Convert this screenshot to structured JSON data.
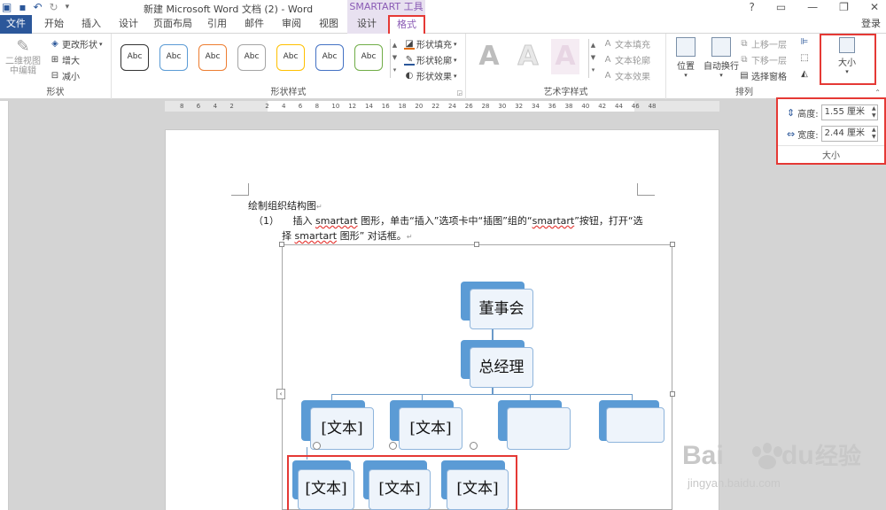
{
  "titlebar": {
    "doc_title": "新建 Microsoft Word 文档 (2) - Word",
    "context_label": "SMARTART 工具",
    "win_help": "?",
    "win_minimize": "—",
    "win_restore": "❐",
    "win_close": "✕"
  },
  "tabs": {
    "file": "文件",
    "items": [
      "开始",
      "插入",
      "设计",
      "页面布局",
      "引用",
      "邮件",
      "审阅",
      "视图"
    ],
    "ctx_design": "设计",
    "ctx_format": "格式",
    "login": "登录"
  },
  "ribbon": {
    "shape_group": {
      "label": "形状",
      "edit_2d": "二维视图中编辑",
      "change_shape": "更改形状",
      "larger": "增大",
      "smaller": "减小"
    },
    "shape_styles": {
      "label": "形状样式",
      "sample": "Abc",
      "fill": "形状填充",
      "outline": "形状轮廓",
      "effects": "形状效果"
    },
    "wordart": {
      "label": "艺术字样式",
      "glyph": "A",
      "text_fill": "文本填充",
      "text_outline": "文本轮廓",
      "text_effects": "文本效果"
    },
    "arrange": {
      "label": "排列",
      "position": "位置",
      "wrap": "自动换行",
      "bring_forward": "上移一层",
      "send_backward": "下移一层",
      "selection_pane": "选择窗格"
    },
    "size_button": "大小"
  },
  "size_panel": {
    "height_label": "高度:",
    "height_value": "1.55 厘米",
    "width_label": "宽度:",
    "width_value": "2.44 厘米",
    "label": "大小"
  },
  "ruler": [
    "8",
    "6",
    "4",
    "2",
    "2",
    "4",
    "6",
    "8",
    "10",
    "12",
    "14",
    "16",
    "18",
    "20",
    "22",
    "24",
    "26",
    "28",
    "30",
    "32",
    "34",
    "36",
    "38",
    "40",
    "42",
    "44",
    "46",
    "48"
  ],
  "document": {
    "heading": "绘制组织结构图",
    "step_num": "（1）",
    "step_text_1a": "插入 ",
    "step_text_1b": "smartart",
    "step_text_1c": " 图形，单击“插入”选项卡中“插图”组的“",
    "step_text_1d": "smartart",
    "step_text_1e": "”按钮，打开“选",
    "step_text_2a": "择 ",
    "step_text_2b": "smartart",
    "step_text_2c": " 图形” 对话框。"
  },
  "smartart": {
    "board": "董事会",
    "manager": "总经理",
    "placeholder": "[文本]"
  },
  "watermark": {
    "brand": "Bai",
    "brand2": "du",
    "cn": "经验",
    "url": "jingyan.baidu.com"
  },
  "colors": {
    "accent": "#2b579a",
    "context": "#8a5bb5",
    "highlight": "#e53935",
    "node": "#5b9bd5"
  }
}
